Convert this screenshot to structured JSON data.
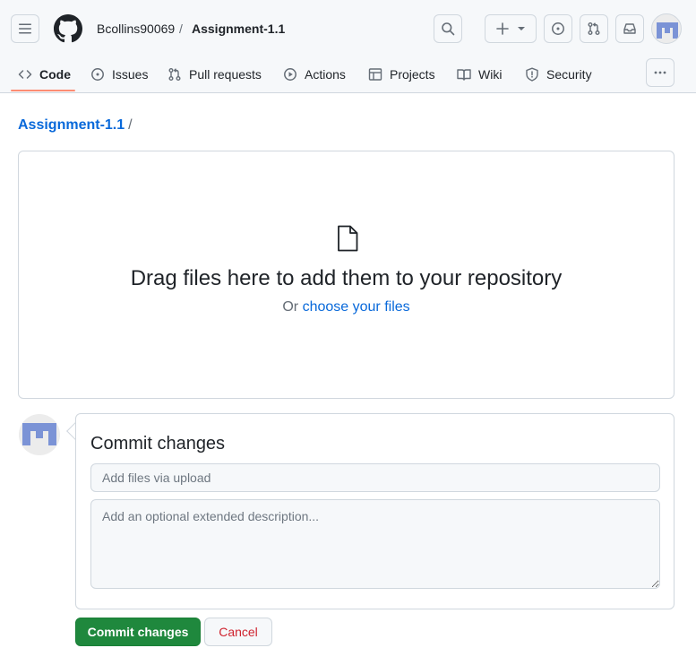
{
  "header": {
    "owner": "Bcollins90069",
    "separator": "/",
    "repo": "Assignment-1.1",
    "icons": [
      "hamburger-icon",
      "github-logo",
      "search-icon",
      "plus-icon",
      "triangle-down-icon",
      "issue-opened-icon",
      "git-pull-request-icon",
      "inbox-icon",
      "avatar"
    ]
  },
  "tabs": [
    {
      "label": "Code",
      "icon": "code-icon",
      "active": true
    },
    {
      "label": "Issues",
      "icon": "issue-opened-icon"
    },
    {
      "label": "Pull requests",
      "icon": "git-pull-request-icon"
    },
    {
      "label": "Actions",
      "icon": "play-icon"
    },
    {
      "label": "Projects",
      "icon": "table-icon"
    },
    {
      "label": "Wiki",
      "icon": "book-icon"
    },
    {
      "label": "Security",
      "icon": "shield-icon"
    }
  ],
  "path": {
    "repo_link": "Assignment-1.1",
    "slash": "/"
  },
  "dropzone": {
    "title": "Drag files here to add them to your repository",
    "or_text": "Or",
    "choose_link": "choose your files"
  },
  "commit": {
    "title": "Commit changes",
    "summary_placeholder": "Add files via upload",
    "description_placeholder": "Add an optional extended description...",
    "commit_button": "Commit changes",
    "cancel_button": "Cancel"
  },
  "colors": {
    "accent_link": "#0969da",
    "commit_green": "#1f883d",
    "cancel_red": "#cf222e",
    "active_tab_underline": "#fd8c73",
    "avatar_blue": "#7b93d6"
  }
}
